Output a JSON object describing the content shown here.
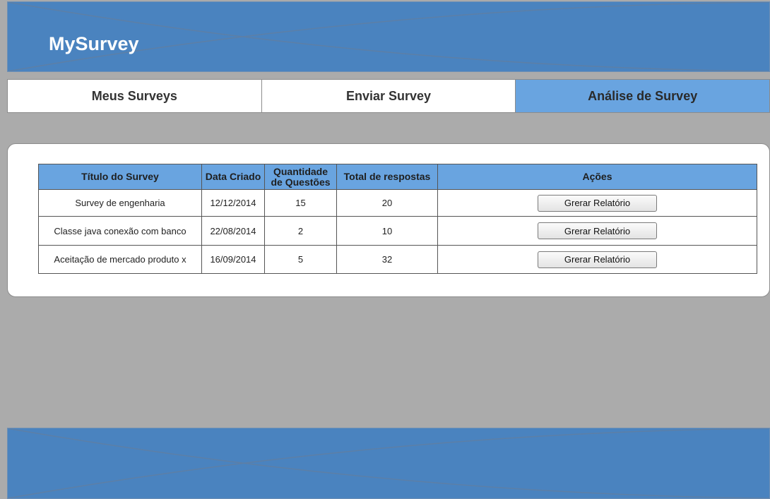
{
  "header": {
    "app_title": "MySurvey"
  },
  "nav": {
    "tabs": [
      {
        "label": "Meus Surveys",
        "active": false
      },
      {
        "label": "Enviar Survey",
        "active": false
      },
      {
        "label": "Análise de Survey",
        "active": true
      }
    ]
  },
  "table": {
    "columns": [
      "Título do Survey",
      "Data Criado",
      "Quantidade de Questões",
      "Total de respostas",
      "Ações"
    ],
    "rows": [
      {
        "title": "Survey de engenharia",
        "date": "12/12/2014",
        "questions": "15",
        "responses": "20",
        "action_label": "Grerar Relatório"
      },
      {
        "title": "Classe java conexão com banco",
        "date": "22/08/2014",
        "questions": "2",
        "responses": "10",
        "action_label": "Grerar Relatório"
      },
      {
        "title": "Aceitação de mercado produto x",
        "date": "16/09/2014",
        "questions": "5",
        "responses": "32",
        "action_label": "Grerar Relatório"
      }
    ]
  },
  "colors": {
    "background": "#ababab",
    "banner": "#4a83bf",
    "accent": "#69a4e0",
    "panel": "#ffffff"
  }
}
